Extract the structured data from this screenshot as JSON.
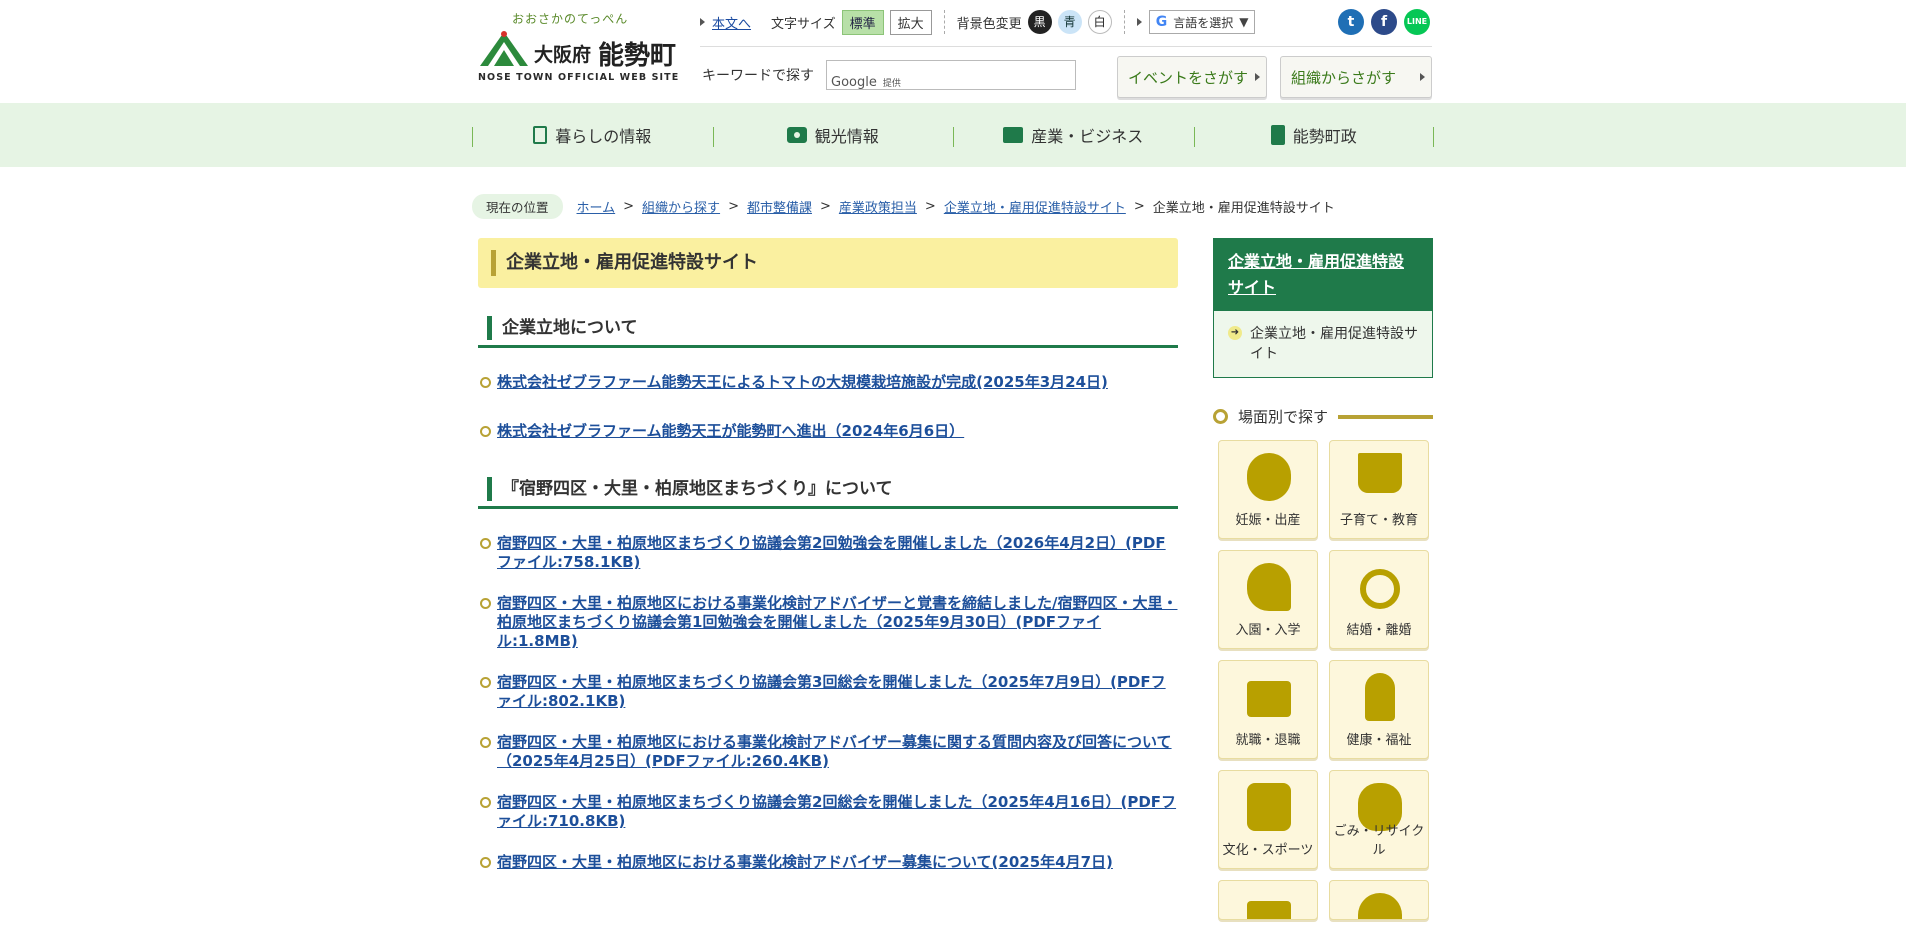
{
  "header": {
    "tagline": "おおさかのてっぺん",
    "pref": "大阪府",
    "town": "能勢町",
    "en": "NOSE TOWN OFFICIAL WEB SITE",
    "skip_link": "本文へ",
    "font_size_label": "文字サイズ",
    "font_std": "標準",
    "font_large": "拡大",
    "bg_label": "背景色変更",
    "bg_black": "黒",
    "bg_blue": "青",
    "bg_white": "白",
    "lang_label": "言語を選択",
    "lang_arrow": "▼",
    "sns_twitter": "t",
    "sns_facebook": "f",
    "sns_line": "LINE",
    "search_label": "キーワードで探す",
    "search_google": "Google",
    "search_provided": "提供",
    "event_btn": "イベントをさがす",
    "org_btn": "組織からさがす"
  },
  "nav": {
    "items": [
      {
        "label": "暮らしの情報",
        "icon": "document-icon"
      },
      {
        "label": "観光情報",
        "icon": "camera-icon"
      },
      {
        "label": "産業・ビジネス",
        "icon": "briefcase-icon"
      },
      {
        "label": "能勢町政",
        "icon": "building-icon"
      }
    ]
  },
  "breadcrumb": {
    "here": "現在の位置",
    "items": [
      "ホーム",
      "組織から探す",
      "都市整備課",
      "産業政策担当",
      "企業立地・雇用促進特設サイト"
    ],
    "current": "企業立地・雇用促進特設サイト",
    "sep": ">"
  },
  "main": {
    "title": "企業立地・雇用促進特設サイト",
    "section1": {
      "heading": "企業立地について",
      "links": [
        "株式会社ゼブラファーム能勢天王によるトマトの大規模栽培施設が完成(2025年3月24日)",
        "株式会社ゼブラファーム能勢天王が能勢町へ進出（2024年6月6日）"
      ]
    },
    "section2": {
      "heading": "『宿野四区・大里・柏原地区まちづくり』について",
      "links": [
        "宿野四区・大里・柏原地区まちづくり協議会第2回勉強会を開催しました（2026年4月2日）(PDFファイル:758.1KB)",
        "宿野四区・大里・柏原地区における事業化検討アドバイザーと覚書を締結しました/宿野四区・大里・柏原地区まちづくり協議会第1回勉強会を開催しました（2025年9月30日）(PDFファイル:1.8MB)",
        "宿野四区・大里・柏原地区まちづくり協議会第3回総会を開催しました（2025年7月9日）(PDFファイル:802.1KB)",
        "宿野四区・大里・柏原地区における事業化検討アドバイザー募集に関する質問内容及び回答について（2025年4月25日）(PDFファイル:260.4KB)",
        "宿野四区・大里・柏原地区まちづくり協議会第2回総会を開催しました（2025年4月16日）(PDFファイル:710.8KB)",
        "宿野四区・大里・柏原地区における事業化検討アドバイザー募集について(2025年4月7日)"
      ]
    }
  },
  "sidebar": {
    "box_title": "企業立地・雇用促進特設サイト",
    "box_link": "企業立地・雇用促進特設サイト",
    "scene_heading": "場面別で探す",
    "tiles": [
      {
        "label": "妊娠・出産",
        "icon": "baby-icon"
      },
      {
        "label": "子育て・教育",
        "icon": "book-icon"
      },
      {
        "label": "入園・入学",
        "icon": "flower-icon"
      },
      {
        "label": "結婚・離婚",
        "icon": "ring-icon"
      },
      {
        "label": "就職・退職",
        "icon": "briefcase-icon"
      },
      {
        "label": "健康・福祉",
        "icon": "elder-icon"
      },
      {
        "label": "文化・スポーツ",
        "icon": "culture-icon"
      },
      {
        "label": "ごみ・リサイクル",
        "icon": "garbage-bag-icon"
      },
      {
        "label": "",
        "icon": "truck-icon"
      },
      {
        "label": "",
        "icon": "sun-icon"
      }
    ]
  }
}
